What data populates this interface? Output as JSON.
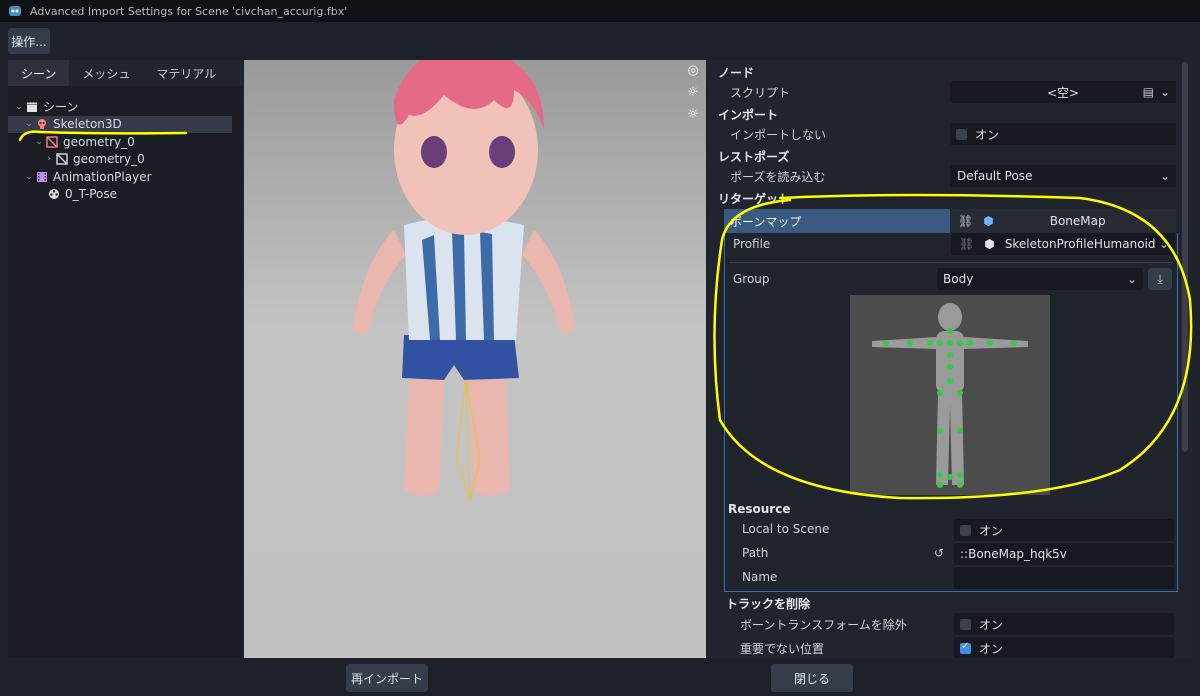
{
  "window": {
    "title": "Advanced Import Settings for Scene 'civchan_accurig.fbx'"
  },
  "toolbar": {
    "ops_label": "操作..."
  },
  "left_panel": {
    "tabs": [
      {
        "label": "シーン"
      },
      {
        "label": "メッシュ"
      },
      {
        "label": "マテリアル"
      }
    ],
    "tree": [
      {
        "label": "シーン"
      },
      {
        "label": "Skeleton3D"
      },
      {
        "label": "geometry_0"
      },
      {
        "label": "geometry_0"
      },
      {
        "label": "AnimationPlayer"
      },
      {
        "label": "0_T-Pose"
      }
    ]
  },
  "inspector": {
    "node": {
      "title": "ノード",
      "script_label": "スクリプト",
      "script_value": "<空>"
    },
    "import": {
      "title": "インポート",
      "skip_label": "インポートしない",
      "skip_value": "オン"
    },
    "rest_pose": {
      "title": "レストポーズ",
      "load_label": "ポーズを読み込む",
      "load_value": "Default Pose"
    },
    "retarget": {
      "title": "リターゲット",
      "bone_map_label": "ボーンマップ",
      "bone_map_value": "BoneMap",
      "profile_label": "Profile",
      "profile_value": "SkeletonProfileHumanoid",
      "group_label": "Group",
      "group_value": "Body"
    },
    "resource": {
      "title": "Resource",
      "local_label": "Local to Scene",
      "local_value": "オン",
      "path_label": "Path",
      "path_value": "::BoneMap_hqk5v",
      "name_label": "Name"
    },
    "remove_tracks": {
      "title": "トラックを削除",
      "except_label": "ボーントランスフォームを除外",
      "except_value": "オン",
      "unimportant_label": "重要でない位置",
      "unimportant_value": "オン"
    }
  },
  "footer": {
    "reimport_label": "再インポート",
    "close_label": "閉じる"
  },
  "colors": {
    "accent": "#3b5a82",
    "annotation": "#ffff00",
    "bone_dot": "#33cc44"
  }
}
